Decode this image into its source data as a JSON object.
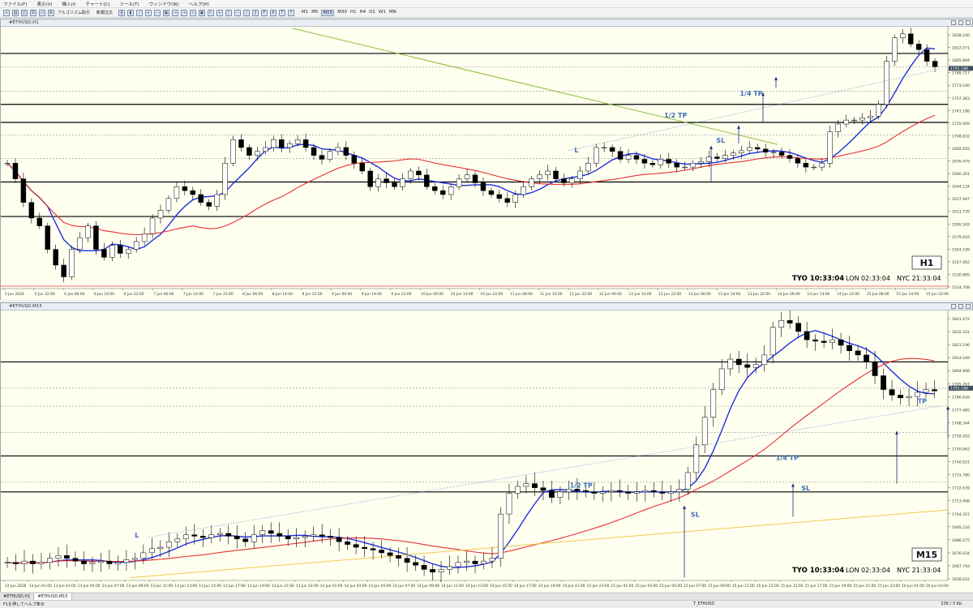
{
  "menu": [
    "ファイル(F)",
    "表示(V)",
    "挿入(I)",
    "チャート(C)",
    "ツール(T)",
    "ウィンドウ(W)",
    "ヘルプ(H)"
  ],
  "toolbar": {
    "algo_label": "アルゴリズム取引",
    "new_order_label": "新規注文",
    "timeframes": [
      "M1",
      "M5",
      "M15",
      "M30",
      "H1",
      "H4",
      "D1",
      "W1",
      "MN"
    ],
    "active_timeframe": "M15"
  },
  "tabs": [
    "#ETHUSD,H1",
    "#ETHUSD,M15"
  ],
  "status": {
    "help": "F1を押してヘルプ表示",
    "symbol": "T_ETHUSD",
    "traffic": "236 / 3 Kb"
  },
  "colors": {
    "background": "#fffff0",
    "bull": "#ffffff",
    "bear": "#000000",
    "ma_fast": "#1f2fe0",
    "ma_mid": "#e53030",
    "ma_slow_h1": "#8cbf3c",
    "ma_slow_m15": "#f2c94c",
    "annot": "#3d6fb0"
  },
  "chart_data": [
    {
      "type": "candlestick",
      "title": "#ETHUSD,H1",
      "timeframe_label": "H1",
      "clock": {
        "tyo": "TYO 10:33:04",
        "lon": "LON 02:33:04",
        "nyc": "NYC 21:33:04"
      },
      "price_ticks": [
        "1838.240",
        "1822.071",
        "1805.894",
        "1789.717",
        "1773.540",
        "1757.363",
        "1741.186",
        "1725.009",
        "1708.832",
        "1692.655",
        "1676.479",
        "1660.301",
        "1644.124",
        "1627.947",
        "1611.770",
        "1595.593",
        "1579.416",
        "1563.239",
        "1547.062",
        "1530.885",
        "1514.708"
      ],
      "current_price": "1791.188",
      "time_ticks": [
        "5 Jun 2026",
        "5 Jun 22:00",
        "6 Jun 06:00",
        "6 Jun 14:00",
        "6 Jun 22:00",
        "7 Jun 06:00",
        "7 Jun 14:00",
        "7 Jun 22:00",
        "8 Jun 06:00",
        "8 Jun 14:00",
        "8 Jun 22:00",
        "9 Jun 06:00",
        "9 Jun 14:00",
        "9 Jun 22:00",
        "10 Jun 06:00",
        "10 Jun 14:00",
        "10 Jun 22:00",
        "11 Jun 06:00",
        "11 Jun 14:00",
        "11 Jun 22:00",
        "12 Jun 06:00",
        "12 Jun 14:00",
        "12 Jun 22:00",
        "13 Jun 06:00",
        "13 Jun 14:00",
        "13 Jun 22:00",
        "14 Jun 06:00",
        "14 Jun 14:00",
        "14 Jun 22:00",
        "15 Jun 06:00",
        "15 Jun 14:00",
        "15 Jun 22:00"
      ],
      "ylim": [
        1510,
        1842
      ],
      "hlines_solid": [
        1810,
        1745,
        1722,
        1646,
        1602
      ],
      "hlines_dotted": [
        1793,
        1762,
        1706,
        1676
      ],
      "annotations": [
        {
          "text": "1/2 TP",
          "x": 0.7,
          "y": 1728
        },
        {
          "text": "1/4 TP",
          "x": 0.78,
          "y": 1756
        },
        {
          "text": "SL",
          "x": 0.755,
          "y": 1696
        },
        {
          "text": "L",
          "x": 0.605,
          "y": 1684
        }
      ],
      "close_series": [
        1670,
        1650,
        1620,
        1600,
        1590,
        1560,
        1540,
        1525,
        1560,
        1575,
        1590,
        1560,
        1550,
        1565,
        1555,
        1560,
        1570,
        1580,
        1600,
        1610,
        1625,
        1640,
        1635,
        1630,
        1620,
        1615,
        1630,
        1670,
        1700,
        1690,
        1680,
        1685,
        1690,
        1700,
        1690,
        1695,
        1700,
        1690,
        1680,
        1675,
        1685,
        1690,
        1680,
        1670,
        1660,
        1640,
        1650,
        1645,
        1640,
        1650,
        1660,
        1655,
        1640,
        1635,
        1630,
        1640,
        1650,
        1655,
        1645,
        1635,
        1630,
        1625,
        1620,
        1630,
        1640,
        1650,
        1655,
        1660,
        1650,
        1645,
        1650,
        1660,
        1670,
        1690,
        1690,
        1685,
        1675,
        1680,
        1675,
        1670,
        1668,
        1675,
        1670,
        1665,
        1665,
        1670,
        1672,
        1678,
        1676,
        1680,
        1683,
        1686,
        1690,
        1688,
        1684,
        1684,
        1680,
        1676,
        1670,
        1665,
        1665,
        1670,
        1710,
        1720,
        1725,
        1725,
        1728,
        1730,
        1745,
        1800,
        1830,
        1835,
        1822,
        1815,
        1800,
        1793
      ]
    },
    {
      "type": "candlestick",
      "title": "#ETHUSD,M15",
      "timeframe_label": "M15",
      "clock": {
        "tyo": "TYO 10:33:04",
        "lon": "LON 02:33:04",
        "nyc": "NYC 21:33:04"
      },
      "price_ticks": [
        "1841.472",
        "1832.331",
        "1823.190",
        "1814.049",
        "1804.908",
        "1795.767",
        "1786.626",
        "1777.485",
        "1768.344",
        "1759.203",
        "1750.062",
        "1740.921",
        "1731.780",
        "1722.639",
        "1713.498",
        "1704.357",
        "1695.216",
        "1686.075",
        "1676.934",
        "1667.793",
        "1658.652"
      ],
      "current_price": "1791.188",
      "time_ticks": [
        "12 Jun 2026",
        "13 Jun 01:00",
        "13 Jun 03:00",
        "13 Jun 05:00",
        "13 Jun 07:00",
        "13 Jun 09:00",
        "13 Jun 11:00",
        "13 Jun 13:00",
        "13 Jun 15:00",
        "13 Jun 17:00",
        "13 Jun 19:00",
        "13 Jun 21:00",
        "13 Jun 23:00",
        "14 Jun 01:00",
        "14 Jun 03:00",
        "14 Jun 05:00",
        "14 Jun 07:00",
        "14 Jun 09:00",
        "14 Jun 11:00",
        "14 Jun 13:00",
        "14 Jun 15:00",
        "14 Jun 17:00",
        "14 Jun 19:00",
        "14 Jun 21:00",
        "14 Jun 23:00",
        "15 Jun 01:00",
        "15 Jun 03:00",
        "15 Jun 05:00",
        "15 Jun 07:00",
        "15 Jun 09:00",
        "15 Jun 11:00",
        "15 Jun 13:00",
        "15 Jun 15:00",
        "15 Jun 17:00",
        "15 Jun 19:00",
        "15 Jun 21:00",
        "15 Jun 23:00",
        "16 Jun 01:00",
        "16 Jun 03:00"
      ],
      "ylim": [
        1652,
        1846
      ],
      "hlines_solid": [
        1810,
        1742,
        1716
      ],
      "hlines_dotted": [
        1791,
        1778,
        1759,
        1723
      ],
      "annotations": [
        {
          "text": "1/2 TP",
          "x": 0.6,
          "y": 1719
        },
        {
          "text": "1/4 TP",
          "x": 0.818,
          "y": 1739
        },
        {
          "text": "SL",
          "x": 0.845,
          "y": 1717
        },
        {
          "text": "SL",
          "x": 0.728,
          "y": 1698
        },
        {
          "text": "TP",
          "x": 0.968,
          "y": 1780
        },
        {
          "text": "L",
          "x": 0.14,
          "y": 1683
        }
      ],
      "close_series": [
        1665,
        1664,
        1666,
        1664,
        1665,
        1668,
        1670,
        1668,
        1666,
        1664,
        1665,
        1666,
        1664,
        1665,
        1667,
        1668,
        1672,
        1675,
        1676,
        1680,
        1682,
        1685,
        1684,
        1683,
        1685,
        1686,
        1684,
        1682,
        1680,
        1685,
        1688,
        1686,
        1684,
        1682,
        1683,
        1684,
        1685,
        1684,
        1683,
        1680,
        1678,
        1676,
        1675,
        1674,
        1672,
        1670,
        1668,
        1665,
        1663,
        1660,
        1658,
        1660,
        1662,
        1665,
        1666,
        1664,
        1666,
        1668,
        1700,
        1715,
        1720,
        1722,
        1719,
        1717,
        1712,
        1716,
        1718,
        1717,
        1716,
        1715,
        1716,
        1717,
        1716,
        1715,
        1716,
        1717,
        1716,
        1715,
        1716,
        1718,
        1730,
        1750,
        1770,
        1790,
        1805,
        1812,
        1808,
        1806,
        1808,
        1815,
        1835,
        1840,
        1838,
        1832,
        1826,
        1825,
        1824,
        1826,
        1822,
        1818,
        1815,
        1810,
        1800,
        1790,
        1786,
        1784,
        1785,
        1788,
        1790,
        1789
      ]
    }
  ]
}
